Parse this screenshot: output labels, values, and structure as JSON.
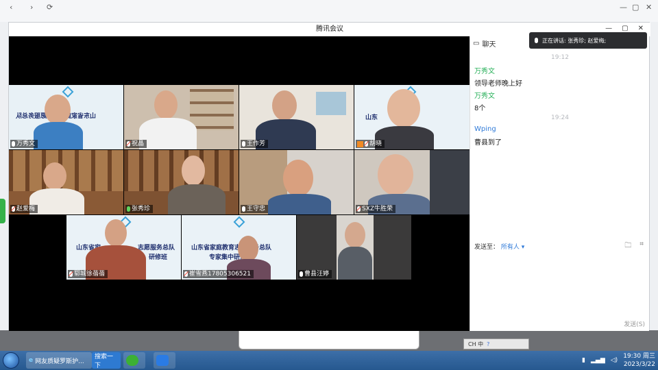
{
  "window_title": "腾讯会议",
  "chat": {
    "tab_label": "聊天",
    "speaking_label": "正在讲话: 张秀珍; 赵爱梅;",
    "messages": [
      {
        "time": "19:12"
      },
      {
        "sender": "万秀文",
        "text": "领导老师晚上好"
      },
      {
        "sender": "万秀文",
        "text": "8个"
      },
      {
        "time": "19:24"
      },
      {
        "sender": "Wping",
        "text": "曹县到了"
      }
    ],
    "send_to_label": "发送至：",
    "send_to_target": "所有人",
    "send_button": "发送(S)"
  },
  "participants": [
    {
      "name": "万秀文",
      "banner": "山东省家庭教育志愿服务总队"
    },
    {
      "name": "祝晶"
    },
    {
      "name": "王作芳"
    },
    {
      "name": "胡晓",
      "banner": "山东"
    },
    {
      "name": "赵爱梅"
    },
    {
      "name": "张秀珍"
    },
    {
      "name": "王守忠"
    },
    {
      "name": "SXZ牛胜荣"
    },
    {
      "name": "郓城徐蓓蓓",
      "banner": "山东省家"
    },
    {
      "name": "崔雪燕17805306521",
      "banner": "山东省家庭教育志愿服务总队"
    },
    {
      "name": "曹县汪婷"
    }
  ],
  "banner_lines": {
    "line2_a": "研修班",
    "line2_b": "专家集中研修班",
    "tile9_right": "志愿服务总队"
  },
  "taskbar": {
    "item1": "网友质疑罗斯护...",
    "item2": "搜索一下",
    "ime": "CH 中",
    "time": "19:30 周三",
    "date": "2023/3/22"
  }
}
